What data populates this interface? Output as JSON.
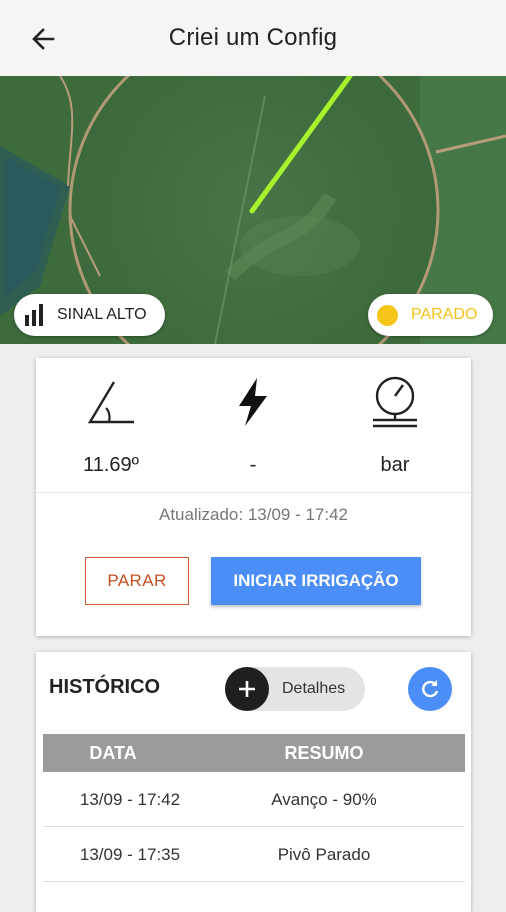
{
  "header": {
    "title": "Criei um Config",
    "back_icon": "arrow-back-icon"
  },
  "map": {
    "signal_label": "SINAL ALTO",
    "status_label": "PARADO",
    "status_color": "#f5c518",
    "pivot_line_color": "#a6f22c"
  },
  "info": {
    "angle_value": "11.69º",
    "power_value": "-",
    "pressure_value": "bar",
    "updated": "Atualizado: 13/09 - 17:42",
    "stop_label": "PARAR",
    "start_label": "INICIAR IRRIGAÇÃO"
  },
  "history": {
    "title": "HISTÓRICO",
    "details_label": "Detalhes",
    "columns": [
      "DATA",
      "RESUMO"
    ],
    "rows": [
      {
        "date": "13/09 - 17:42",
        "summary": "Avanço - 90%"
      },
      {
        "date": "13/09 - 17:35",
        "summary": "Pivô Parado"
      }
    ]
  },
  "colors": {
    "primary": "#4c8ef7",
    "danger": "#c5501f",
    "table_header": "#9b9b9b"
  }
}
